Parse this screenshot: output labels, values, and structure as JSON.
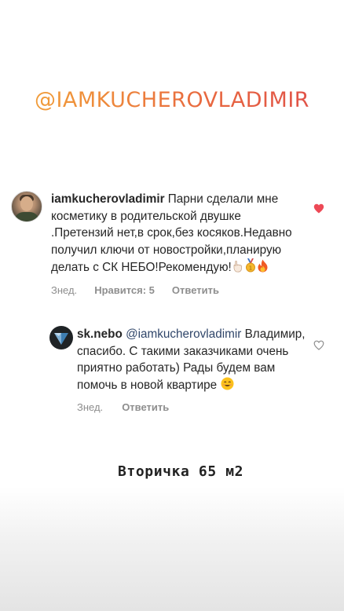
{
  "story": {
    "handle": "@IAMKUCHEROVLADIMIR",
    "caption": "Вторичка 65 м2"
  },
  "comment": {
    "username": "iamkucherovladimir",
    "text": "Парни сделали мне косметику в родительской двушке .Претензий нет,в срок,без косяков.Недавно получил ключи от новостройки,планирую делать с СК НЕБО!Рекомендую!",
    "emojis": [
      "hand-icon",
      "medal-icon",
      "fire-icon"
    ],
    "time": "Знед.",
    "likes": "Нравится: 5",
    "reply_label": "Ответить",
    "liked": true,
    "heart_color": "#ed4956"
  },
  "reply": {
    "username": "sk.nebo",
    "mention": "@iamkucherovladimir",
    "text": "Владимир, спасибо. С такими заказчиками очень приятно работать) Рады будем вам помочь в новой квартире",
    "emojis": [
      "smile-icon"
    ],
    "time": "Знед.",
    "reply_label": "Ответить",
    "liked": false
  }
}
